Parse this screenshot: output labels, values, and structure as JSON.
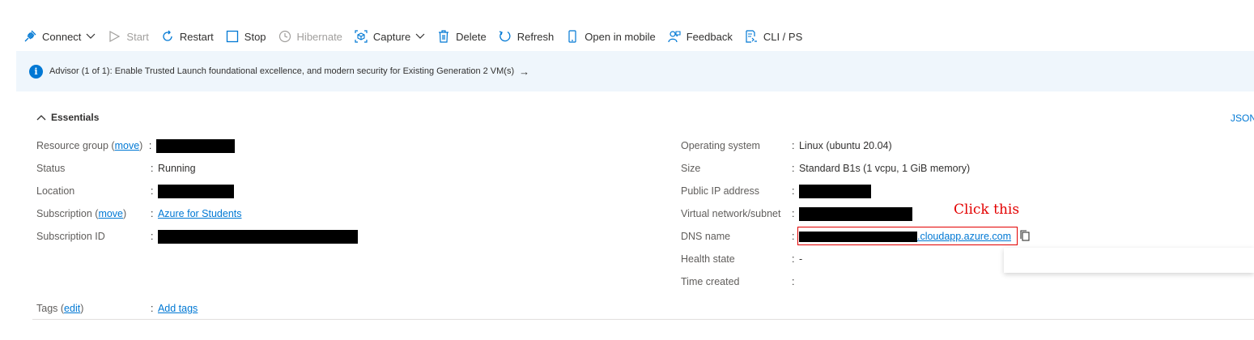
{
  "toolbar": {
    "connect": "Connect",
    "start": "Start",
    "restart": "Restart",
    "stop": "Stop",
    "hibernate": "Hibernate",
    "capture": "Capture",
    "delete": "Delete",
    "refresh": "Refresh",
    "open_mobile": "Open in mobile",
    "feedback": "Feedback",
    "cli": "CLI / PS"
  },
  "advisor": {
    "text": "Advisor (1 of 1): Enable Trusted Launch foundational excellence, and modern security for Existing Generation 2 VM(s)",
    "arrow": "→"
  },
  "essentials": {
    "title": "Essentials",
    "json_link": "JSON",
    "left": {
      "resource_group_label": "Resource group (",
      "resource_group_move": "move",
      "resource_group_close": ")",
      "status_label": "Status",
      "status_value": "Running",
      "location_label": "Location",
      "subscription_label": "Subscription (",
      "subscription_move": "move",
      "subscription_close": ")",
      "subscription_value": "Azure for Students",
      "subscription_id_label": "Subscription ID"
    },
    "right": {
      "os_label": "Operating system",
      "os_value": "Linux (ubuntu 20.04)",
      "size_label": "Size",
      "size_value": "Standard B1s (1 vcpu, 1 GiB memory)",
      "public_ip_label": "Public IP address",
      "vnet_label": "Virtual network/subnet",
      "dns_label": "DNS name",
      "dns_value": ".cloudapp.azure.com",
      "health_label": "Health state",
      "health_value": "-",
      "time_created_label": "Time created"
    },
    "tags": {
      "label": "Tags (",
      "edit": "edit",
      "close": ")",
      "add_tags": "Add tags"
    },
    "colon": ":"
  },
  "annotation": "Click  this",
  "colors": {
    "accent": "#0078d4",
    "annotation_red": "#e30000",
    "banner_bg": "#eff6fc"
  }
}
